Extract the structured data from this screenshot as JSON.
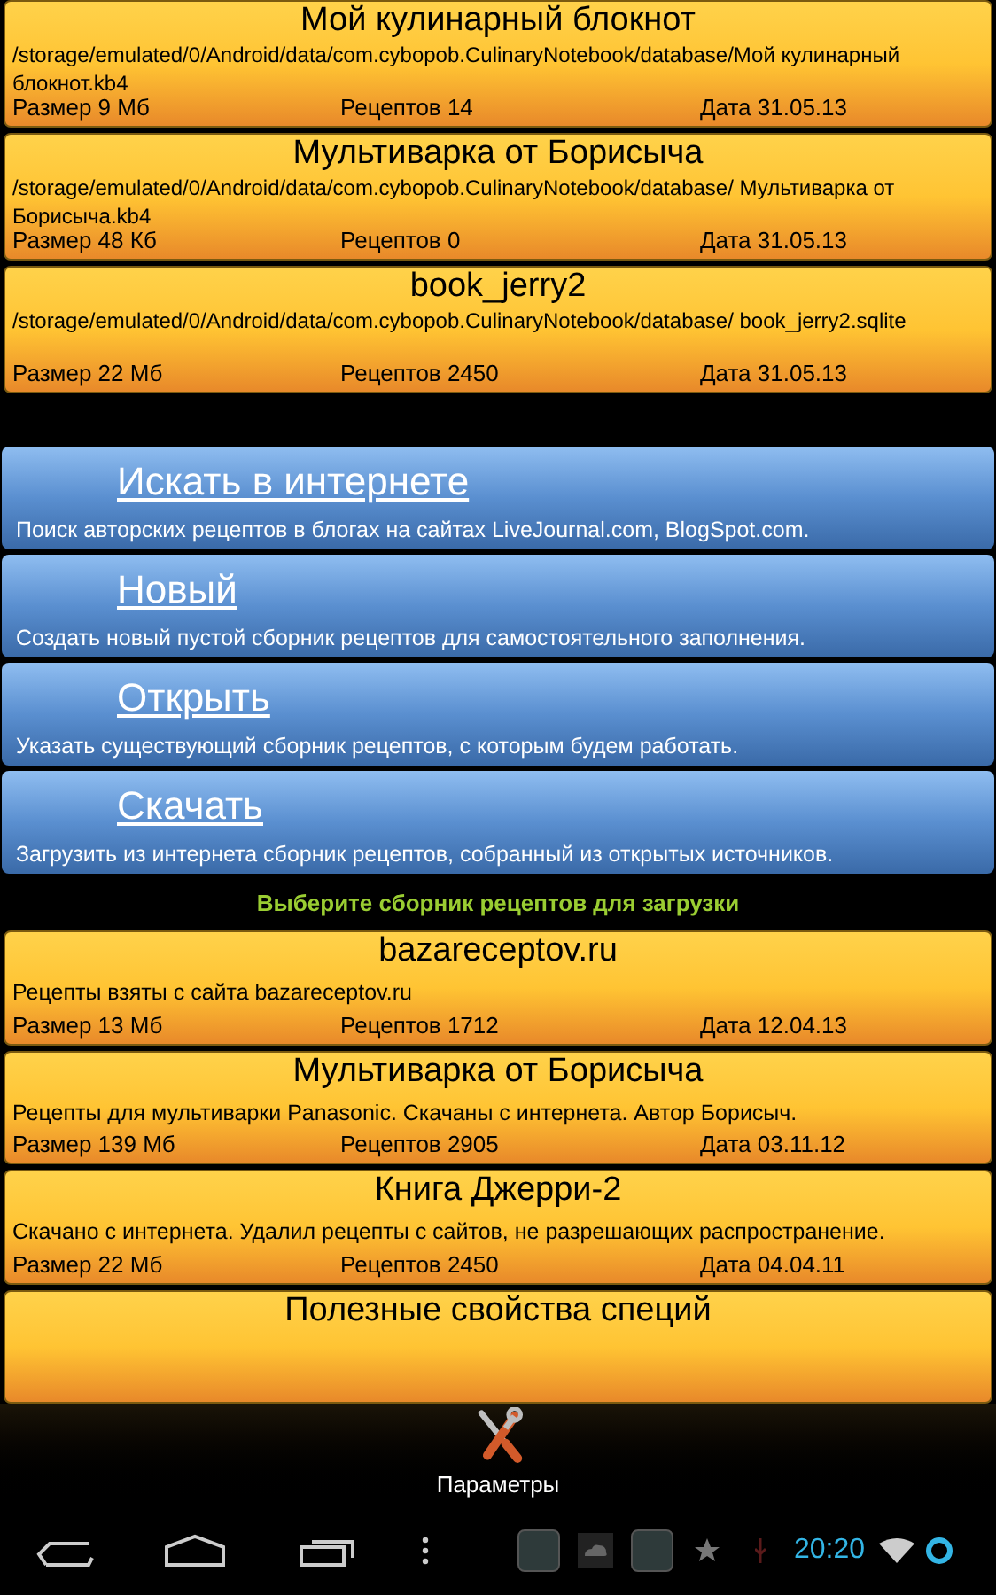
{
  "local_books": [
    {
      "title": "Мой кулинарный блокнот",
      "path": "/storage/emulated/0/Android/data/com.cybopob.CulinaryNotebook/database/Мой кулинарный блокнот.kb4",
      "size": "Размер 9 Мб",
      "recipes": "Рецептов 14",
      "date": "Дата 31.05.13"
    },
    {
      "title": "Мультиварка от Борисыча",
      "path": "/storage/emulated/0/Android/data/com.cybopob.CulinaryNotebook/database/ Мультиварка от Борисыча.kb4",
      "size": "Размер 48 Кб",
      "recipes": "Рецептов 0",
      "date": "Дата 31.05.13"
    },
    {
      "title": "book_jerry2",
      "path": "/storage/emulated/0/Android/data/com.cybopob.CulinaryNotebook/database/ book_jerry2.sqlite",
      "size": "Размер 22 Мб",
      "recipes": "Рецептов 2450",
      "date": "Дата 31.05.13"
    }
  ],
  "actions": [
    {
      "title": "Искать в интернете",
      "description": "Поиск авторских рецептов в блогах на сайтах LiveJournal.com, BlogSpot.com."
    },
    {
      "title": "Новый",
      "description": "Создать новый пустой сборник рецептов для самостоятельного заполнения."
    },
    {
      "title": "Открыть",
      "description": "Указать существующий сборник рецептов, с которым будем работать."
    },
    {
      "title": "Скачать",
      "description": "Загрузить из интернета сборник рецептов, собранный из открытых источников."
    }
  ],
  "download_heading": "Выберите сборник рецептов для загрузки",
  "download_books": [
    {
      "title": "bazareceptov.ru",
      "description": "Рецепты взяты с сайта bazareceptov.ru",
      "size": "Размер 13 Мб",
      "recipes": "Рецептов 1712",
      "date": "Дата 12.04.13"
    },
    {
      "title": "Мультиварка от Борисыча",
      "description": "Рецепты для мультиварки Panasonic. Скачаны с интернета. Автор Борисыч.",
      "size": "Размер 139 Мб",
      "recipes": "Рецептов 2905",
      "date": "Дата 03.11.12"
    },
    {
      "title": "Книга Джерри-2",
      "description": "Скачано с интернета. Удалил рецепты с сайтов, не разрешающих распространение.",
      "size": "Размер 22 Мб",
      "recipes": "Рецептов 2450",
      "date": "Дата 04.04.11"
    },
    {
      "title": "Полезные свойства специй"
    }
  ],
  "options_menu": {
    "label": "Параметры"
  },
  "status_bar": {
    "time": "20:20"
  }
}
